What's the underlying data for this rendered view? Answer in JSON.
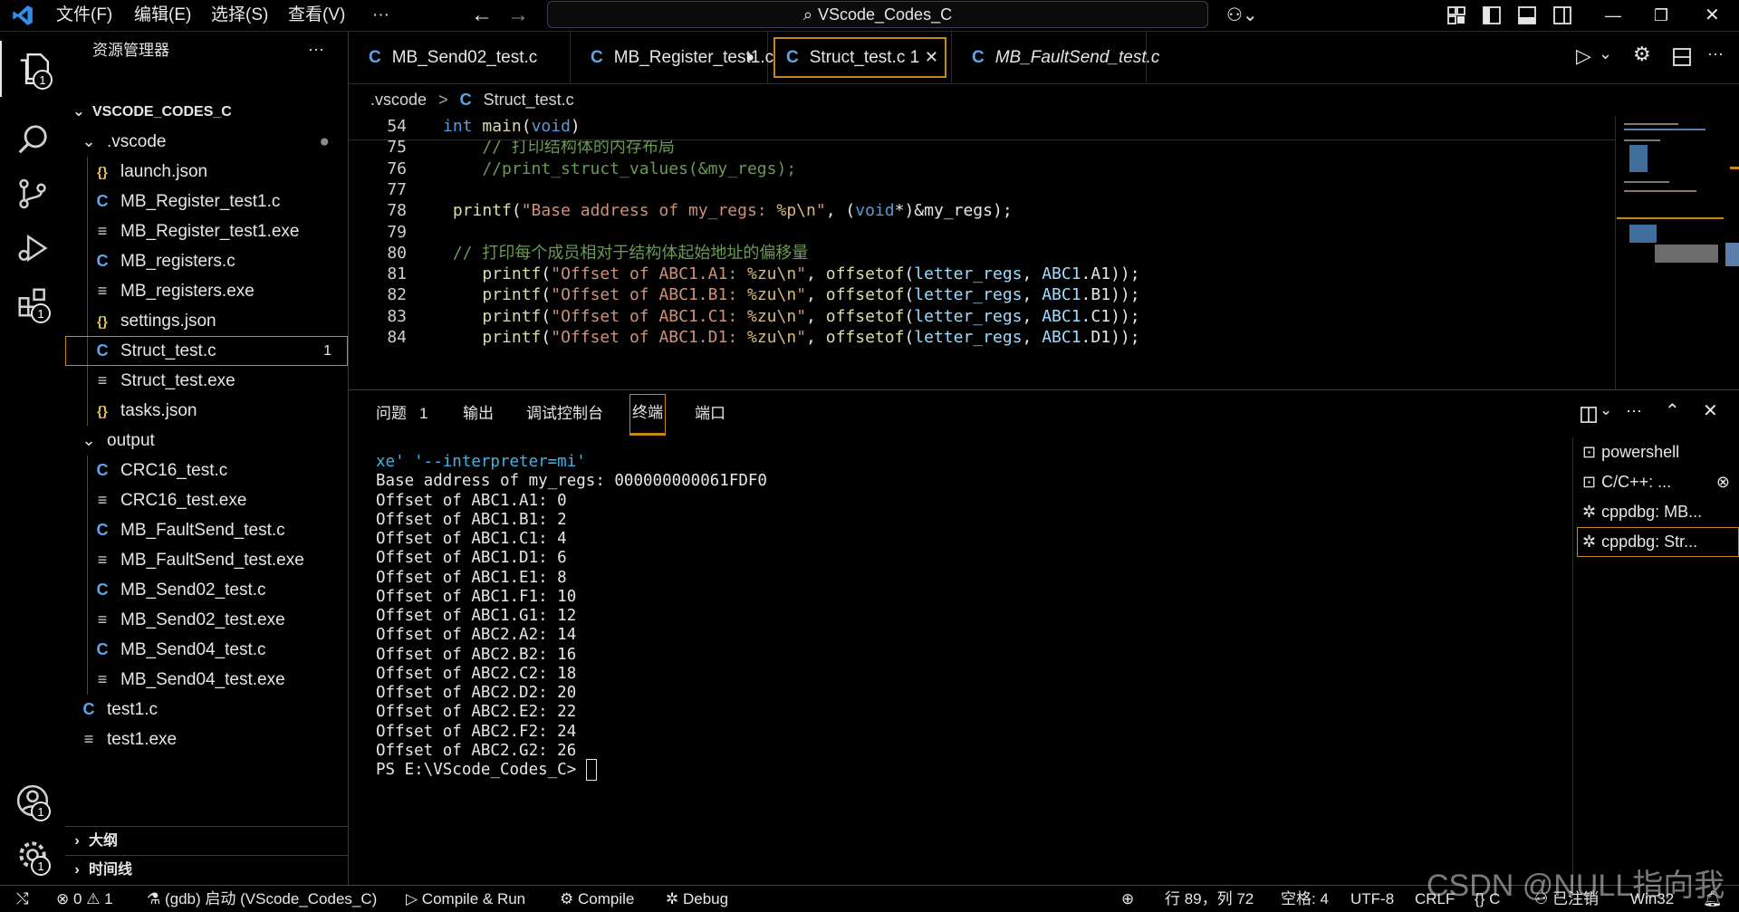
{
  "titlebar": {
    "menus": [
      "文件(F)",
      "编辑(E)",
      "选择(S)",
      "查看(V)",
      "···"
    ],
    "search": "VScode_Codes_C"
  },
  "activity": {
    "explorer_badge": "1",
    "extensions_badge": "1",
    "accounts_badge": "1",
    "settings_badge": "1"
  },
  "sidebar": {
    "title": "资源管理器",
    "more": "···",
    "root": "VSCODE_CODES_C",
    "items": [
      {
        "label": ".vscode",
        "type": "folder"
      },
      {
        "label": "launch.json",
        "type": "json"
      },
      {
        "label": "MB_Register_test1.c",
        "type": "c"
      },
      {
        "label": "MB_Register_test1.exe",
        "type": "exe"
      },
      {
        "label": "MB_registers.c",
        "type": "c"
      },
      {
        "label": "MB_registers.exe",
        "type": "exe"
      },
      {
        "label": "settings.json",
        "type": "json"
      },
      {
        "label": "Struct_test.c",
        "type": "c",
        "badge": "1"
      },
      {
        "label": "Struct_test.exe",
        "type": "exe"
      },
      {
        "label": "tasks.json",
        "type": "json"
      },
      {
        "label": "output",
        "type": "folder"
      },
      {
        "label": "CRC16_test.c",
        "type": "c"
      },
      {
        "label": "CRC16_test.exe",
        "type": "exe"
      },
      {
        "label": "MB_FaultSend_test.c",
        "type": "c"
      },
      {
        "label": "MB_FaultSend_test.exe",
        "type": "exe"
      },
      {
        "label": "MB_Send02_test.c",
        "type": "c"
      },
      {
        "label": "MB_Send02_test.exe",
        "type": "exe"
      },
      {
        "label": "MB_Send04_test.c",
        "type": "c"
      },
      {
        "label": "MB_Send04_test.exe",
        "type": "exe"
      },
      {
        "label": "test1.c",
        "type": "c"
      },
      {
        "label": "test1.exe",
        "type": "exe"
      }
    ],
    "outline": "大纲",
    "timeline": "时间线"
  },
  "tabs": [
    {
      "label": "MB_Send02_test.c"
    },
    {
      "label": "MB_Register_test1.c"
    },
    {
      "label": "Struct_test.c",
      "badge": "1"
    },
    {
      "label": "MB_FaultSend_test.c"
    }
  ],
  "breadcrumb": {
    "folder": ".vscode",
    "sep": ">",
    "file": "Struct_test.c"
  },
  "editor": {
    "lines": [
      {
        "num": "54",
        "text": "int main(void)"
      },
      {
        "num": "75",
        "text": "    // 打印结构体的内存布局"
      },
      {
        "num": "76",
        "text": "    //print_struct_values(&my_regs);"
      },
      {
        "num": "77",
        "text": ""
      },
      {
        "num": "78",
        "text": " printf(\"Base address of my_regs: %p\\n\", (void*)&my_regs);"
      },
      {
        "num": "79",
        "text": ""
      },
      {
        "num": "80",
        "text": " // 打印每个成员相对于结构体起始地址的偏移量"
      },
      {
        "num": "81",
        "text": "    printf(\"Offset of ABC1.A1: %zu\\n\", offsetof(letter_regs, ABC1.A1));"
      },
      {
        "num": "82",
        "text": "    printf(\"Offset of ABC1.B1: %zu\\n\", offsetof(letter_regs, ABC1.B1));"
      },
      {
        "num": "83",
        "text": "    printf(\"Offset of ABC1.C1: %zu\\n\", offsetof(letter_regs, ABC1.C1));"
      },
      {
        "num": "84",
        "text": "    printf(\"Offset of ABC1.D1: %zu\\n\", offsetof(letter_regs, ABC1.D1));"
      }
    ]
  },
  "panel": {
    "tabs": [
      "问题",
      "输出",
      "调试控制台",
      "终端",
      "端口"
    ],
    "problems_count": "1",
    "terminal_lines": [
      "xe' '--interpreter=mi'",
      "Base address of my_regs: 000000000061FDF0",
      "Offset of ABC1.A1: 0",
      "Offset of ABC1.B1: 2",
      "Offset of ABC1.C1: 4",
      "Offset of ABC1.D1: 6",
      "Offset of ABC1.E1: 8",
      "Offset of ABC1.F1: 10",
      "Offset of ABC1.G1: 12",
      "Offset of ABC2.A2: 14",
      "Offset of ABC2.B2: 16",
      "Offset of ABC2.C2: 18",
      "Offset of ABC2.D2: 20",
      "Offset of ABC2.E2: 22",
      "Offset of ABC2.F2: 24",
      "Offset of ABC2.G2: 26",
      "PS E:\\VScode_Codes_C> "
    ],
    "terminals": [
      "powershell",
      "C/C++: ...",
      "cppdbg: MB...",
      "cppdbg: Str..."
    ]
  },
  "statusbar": {
    "errors": "0",
    "warnings": "1",
    "debug": "(gdb) 启动 (VScode_Codes_C)",
    "compile_run": "Compile & Run",
    "compile": "Compile",
    "debug_btn": "Debug",
    "position": "行 89，列 72",
    "spaces": "空格: 4",
    "encoding": "UTF-8",
    "eol": "CRLF",
    "language": "C",
    "account": "已注销",
    "platform": "Win32"
  },
  "watermark": "CSDN @NULL指向我",
  "colors": {
    "accent": "#c7851a",
    "c_icon": "#5fa3e8",
    "json_icon": "#e6c35c"
  }
}
